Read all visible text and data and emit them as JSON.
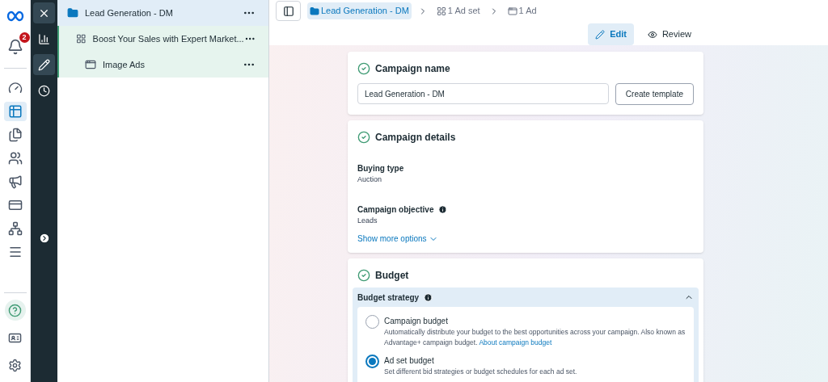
{
  "nav_rail": {
    "notification_count": "2",
    "items": [
      {
        "kind": "gauge",
        "selected": false
      },
      {
        "kind": "table",
        "selected": true
      },
      {
        "kind": "pages",
        "selected": false
      },
      {
        "kind": "people",
        "selected": false
      },
      {
        "kind": "megaphone",
        "selected": false
      },
      {
        "kind": "card",
        "selected": false
      },
      {
        "kind": "network",
        "selected": false
      },
      {
        "kind": "menu",
        "selected": false
      }
    ],
    "bottom_items": [
      {
        "kind": "help"
      },
      {
        "kind": "idcard"
      },
      {
        "kind": "settings"
      }
    ]
  },
  "tool_rail": {
    "items": [
      {
        "kind": "close",
        "selected": true
      },
      {
        "kind": "chart",
        "selected": false
      },
      {
        "kind": "edit",
        "selected": true
      },
      {
        "kind": "history",
        "selected": false
      }
    ]
  },
  "tree": {
    "rows": [
      {
        "kind": "campaign",
        "label": "Lead Generation - DM",
        "selected": true
      },
      {
        "kind": "adset",
        "label": "Boost Your Sales with Expert Market...",
        "selected": false
      },
      {
        "kind": "ad",
        "label": "Image Ads",
        "selected": false
      }
    ]
  },
  "breadcrumbs": [
    {
      "kind": "campaign",
      "label": "Lead Generation - DM",
      "selected": true
    },
    {
      "kind": "adset",
      "label": "1 Ad set",
      "selected": false
    },
    {
      "kind": "ad",
      "label": "1 Ad",
      "selected": false
    }
  ],
  "mode_tabs": [
    {
      "kind": "edit",
      "label": "Edit",
      "selected": true
    },
    {
      "kind": "review",
      "label": "Review",
      "selected": false
    }
  ],
  "campaign_name": {
    "title": "Campaign name",
    "value": "Lead Generation - DM",
    "button": "Create template"
  },
  "campaign_details": {
    "title": "Campaign details",
    "fields": [
      {
        "label": "Buying type",
        "value": "Auction",
        "info": false
      },
      {
        "label": "Campaign objective",
        "value": "Leads",
        "info": true
      }
    ],
    "more_link": "Show more options"
  },
  "budget": {
    "title": "Budget",
    "strategy": {
      "title": "Budget strategy",
      "expanded": true,
      "options": [
        {
          "label": "Campaign budget",
          "description": "Automatically distribute your budget to the best opportunities across your campaign. Also known as Advantage+ campaign budget.",
          "link": "About campaign budget",
          "selected": false
        },
        {
          "label": "Ad set budget",
          "description": "Set different bid strategies or budget schedules for each ad set.",
          "selected": true
        }
      ]
    }
  }
}
